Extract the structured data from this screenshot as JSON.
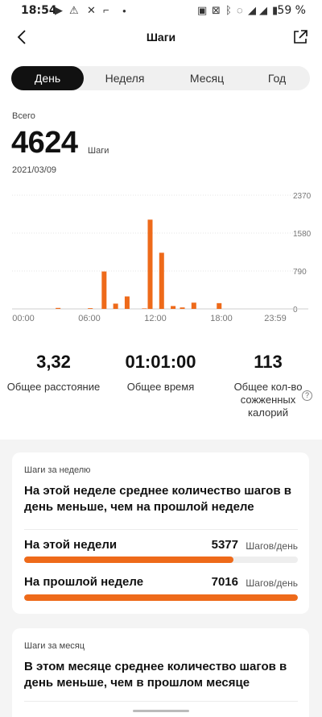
{
  "status_bar": {
    "time": "18:54",
    "battery": "59 %"
  },
  "header": {
    "title": "Шаги"
  },
  "tabs": [
    {
      "label": "День",
      "active": true
    },
    {
      "label": "Неделя",
      "active": false
    },
    {
      "label": "Месяц",
      "active": false
    },
    {
      "label": "Год",
      "active": false
    }
  ],
  "summary": {
    "total_label": "Всего",
    "total_value": "4624",
    "unit": "Шаги",
    "date": "2021/03/09"
  },
  "chart_data": {
    "type": "bar",
    "title": "",
    "xlabel": "",
    "ylabel": "",
    "x_tick_labels": [
      "00:00",
      "06:00",
      "12:00",
      "18:00",
      "23:59"
    ],
    "y_tick_labels": [
      "2370",
      "1580",
      "790",
      "0"
    ],
    "ylim": [
      0,
      2370
    ],
    "grid": true,
    "bar_color": "#ee6a1a",
    "series": [
      {
        "values": [
          {
            "hour": 4.0,
            "value": 20
          },
          {
            "hour": 6.8,
            "value": 15
          },
          {
            "hour": 8.0,
            "value": 780
          },
          {
            "hour": 9.0,
            "value": 110
          },
          {
            "hour": 10.0,
            "value": 260
          },
          {
            "hour": 11.5,
            "value": 10
          },
          {
            "hour": 12.0,
            "value": 1860
          },
          {
            "hour": 13.0,
            "value": 1170
          },
          {
            "hour": 14.0,
            "value": 60
          },
          {
            "hour": 14.8,
            "value": 30
          },
          {
            "hour": 15.8,
            "value": 130
          },
          {
            "hour": 18.0,
            "value": 120
          }
        ]
      }
    ]
  },
  "stats": [
    {
      "value": "3,32",
      "label": "Общее расстояние"
    },
    {
      "value": "01:01:00",
      "label": "Общее время"
    },
    {
      "value": "113",
      "label": "Общее кол-во сожженных калорий"
    }
  ],
  "weekly_card": {
    "title": "Шаги за неделю",
    "description": "На этой неделе среднее количество шагов в день меньше, чем на прошлой неделе",
    "rows": [
      {
        "label": "На этой недели",
        "value": "5377",
        "unit": "Шагов/день",
        "fraction": 0.766
      },
      {
        "label": "На прошлой неделе",
        "value": "7016",
        "unit": "Шагов/день",
        "fraction": 1.0
      }
    ],
    "accent": "#ee6a1a"
  },
  "monthly_card": {
    "title": "Шаги за месяц",
    "description": "В этом месяце среднее количество шагов в день меньше, чем в прошлом месяце"
  }
}
